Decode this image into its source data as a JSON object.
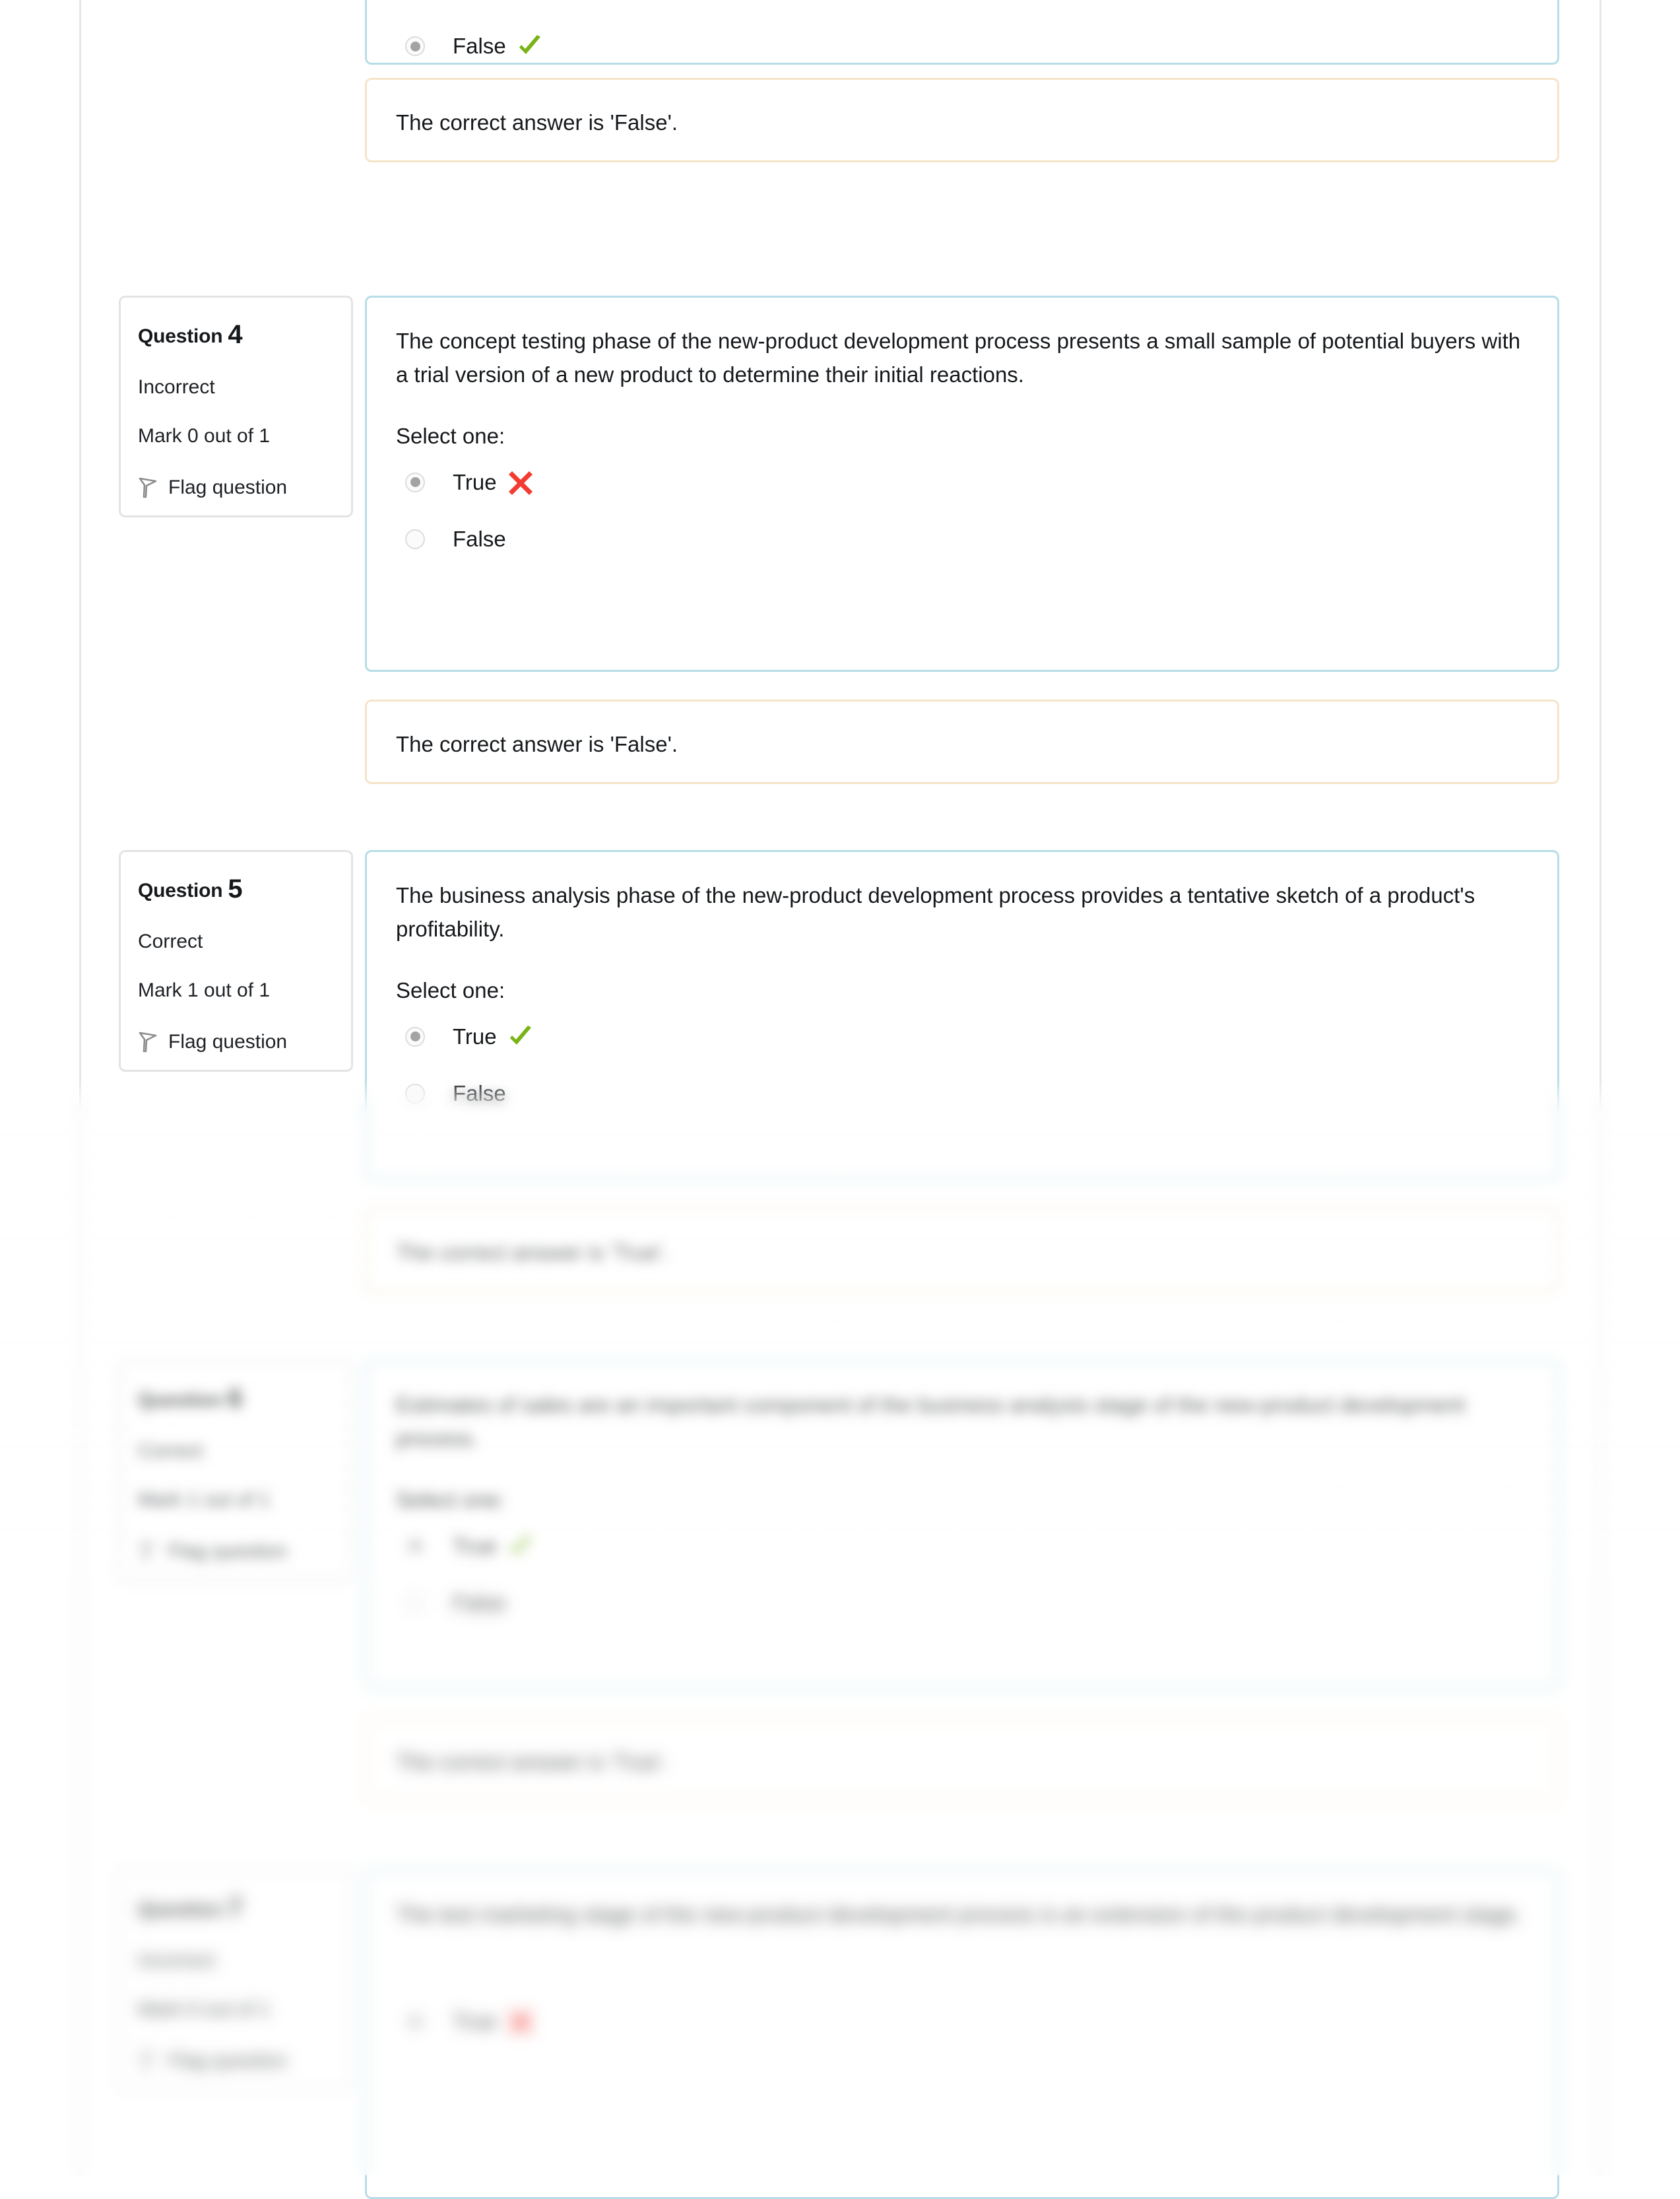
{
  "colors": {
    "question_border": "#b7dde6",
    "feedback_border": "#f6e4c8",
    "info_border": "#e3e3e3",
    "correct_mark": "#7ab317",
    "incorrect_mark": "#f23c31",
    "frame_rule": "#e7e7e7"
  },
  "labels": {
    "question_word": "Question",
    "select_one": "Select one:",
    "flag_question": "Flag question",
    "flag_icon": "flag-icon"
  },
  "top_partial": {
    "answer_label": "False",
    "answer_mark": "correct-check-icon",
    "feedback": "The correct answer is 'False'."
  },
  "questions": [
    {
      "number": "4",
      "state": "Incorrect",
      "mark": "Mark 0 out of 1",
      "text": "The concept testing phase of the new-product development process presents a small sample of potential buyers with a trial version of a new product to determine their initial reactions.",
      "options": [
        {
          "label": "True",
          "selected": true,
          "mark": "incorrect-cross-icon"
        },
        {
          "label": "False",
          "selected": false,
          "mark": "none"
        }
      ],
      "feedback": "The correct answer is 'False'."
    },
    {
      "number": "5",
      "state": "Correct",
      "mark": "Mark 1 out of 1",
      "text": "The business analysis phase of the new-product development process provides a tentative sketch of a product's profitability.",
      "options": [
        {
          "label": "True",
          "selected": true,
          "mark": "correct-check-icon"
        },
        {
          "label": "False",
          "selected": false,
          "mark": "none"
        }
      ],
      "feedback": "The correct answer is 'True'."
    },
    {
      "number": "6",
      "state": "Correct",
      "mark": "Mark 1 out of 1",
      "text": "Estimates of sales are an important component of the business analysis stage of the new-product development process.",
      "options": [
        {
          "label": "True",
          "selected": true,
          "mark": "correct-check-icon"
        },
        {
          "label": "False",
          "selected": false,
          "mark": "none"
        }
      ],
      "feedback": "The correct answer is 'True'."
    },
    {
      "number": "7",
      "state": "Incorrect",
      "mark": "Mark 0 out of 1",
      "text": "The test marketing stage of the new-product development process is an extension of the product development stage.",
      "options": [
        {
          "label": "True",
          "selected": true,
          "mark": "incorrect-cross-icon"
        }
      ],
      "feedback": ""
    }
  ]
}
